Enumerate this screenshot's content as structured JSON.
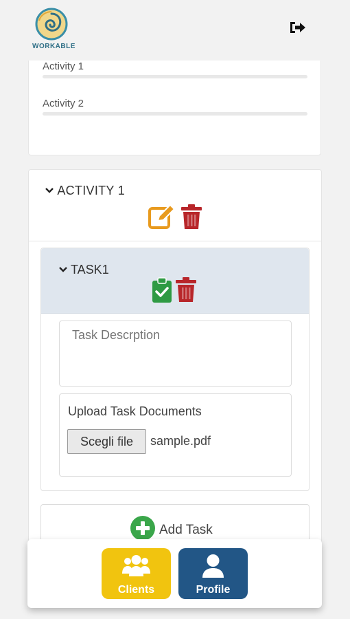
{
  "app": {
    "logo_text": "WORKABLE"
  },
  "summary": {
    "activities": [
      {
        "label": "Activity 1",
        "progress": 0
      },
      {
        "label": "Activity 2",
        "progress": 0
      }
    ]
  },
  "activity": {
    "title": "ACTIVITY 1",
    "task": {
      "title": "TASK1",
      "description_placeholder": "Task Descrption",
      "upload_label": "Upload Task Documents",
      "file_button": "Scegli file",
      "file_name": "sample.pdf"
    },
    "add_task_label": "Add Task"
  },
  "nav": {
    "clients_label": "Clients",
    "profile_label": "Profile"
  },
  "colors": {
    "edit": "#e89a1e",
    "delete": "#b8262a",
    "done": "#2e9a43",
    "add": "#3aa64a",
    "clients": "#f1c40f",
    "profile": "#225686"
  },
  "icons": [
    "logout-icon",
    "edit-icon",
    "trash-icon",
    "clipboard-check-icon",
    "plus-circle-icon",
    "users-icon",
    "user-icon",
    "chevron-down-icon"
  ]
}
